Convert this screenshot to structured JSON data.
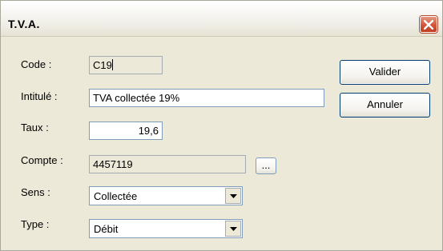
{
  "window": {
    "title": "T.V.A."
  },
  "icons": {
    "close": "close-x-icon",
    "dropdown": "chevron-down-icon"
  },
  "colors": {
    "close_button": "#d2553a",
    "button_border": "#003c74",
    "field_border": "#7f9db9",
    "dialog_bg": "#ece9d8"
  },
  "form": {
    "code": {
      "label": "Code :",
      "value": "C19"
    },
    "intitule": {
      "label": "Intitulé :",
      "value": "TVA collectée 19%"
    },
    "taux": {
      "label": "Taux :",
      "value": "19,6"
    },
    "compte": {
      "label": "Compte :",
      "value": "4457119",
      "browse_label": "..."
    },
    "sens": {
      "label": "Sens :",
      "selected": "Collectée"
    },
    "type": {
      "label": "Type :",
      "selected": "Débit"
    }
  },
  "buttons": {
    "valider": "Valider",
    "annuler": "Annuler"
  }
}
